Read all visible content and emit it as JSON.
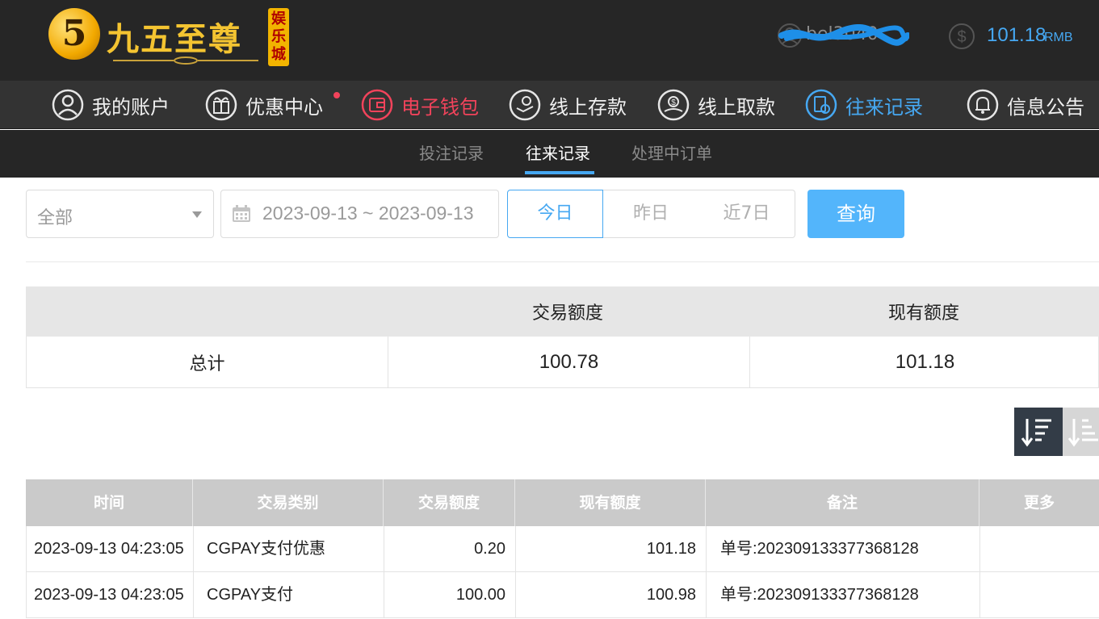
{
  "header": {
    "logo": {
      "numeral": "5",
      "name": "九五至尊",
      "stamp": "娱乐城"
    },
    "user": {
      "name": "bel3040"
    },
    "balance": {
      "value": "101.18",
      "unit": "RMB"
    }
  },
  "mainnav": {
    "items": [
      {
        "label": "我的账户",
        "icon": "user-icon"
      },
      {
        "label": "优惠中心",
        "icon": "gift-icon"
      },
      {
        "label": "电子钱包",
        "icon": "wallet-icon"
      },
      {
        "label": "线上存款",
        "icon": "deposit-icon"
      },
      {
        "label": "线上取款",
        "icon": "withdraw-icon"
      },
      {
        "label": "往来记录",
        "icon": "records-icon"
      },
      {
        "label": "信息公告",
        "icon": "bell-icon"
      }
    ]
  },
  "subnav": {
    "items": [
      {
        "label": "投注记录"
      },
      {
        "label": "往来记录"
      },
      {
        "label": "处理中订单"
      }
    ]
  },
  "filters": {
    "type_select": "全部",
    "date_range": "2023-09-13 ~ 2023-09-13",
    "quick": {
      "today": "今日",
      "yesterday": "昨日",
      "week": "近7日"
    },
    "search": "查询"
  },
  "summary": {
    "headers": [
      "",
      "交易额度",
      "现有额度"
    ],
    "row": {
      "label": "总计",
      "amount": "100.78",
      "balance": "101.18"
    }
  },
  "records": {
    "headers": [
      "时间",
      "交易类别",
      "交易额度",
      "现有额度",
      "备注",
      "更多"
    ],
    "rows": [
      {
        "time": "2023-09-13 04:23:05",
        "type": "CGPAY支付优惠",
        "amount": "0.20",
        "balance": "101.18",
        "note": "单号:202309133377368128",
        "more": ""
      },
      {
        "time": "2023-09-13 04:23:05",
        "type": "CGPAY支付",
        "amount": "100.00",
        "balance": "100.98",
        "note": "单号:202309133377368128",
        "more": ""
      }
    ]
  },
  "colors": {
    "accent": "#46a8f2",
    "highlight_red": "#f2435b",
    "header_bg": "#262626",
    "nav_bg": "#333333",
    "gold": "#f4c431"
  }
}
